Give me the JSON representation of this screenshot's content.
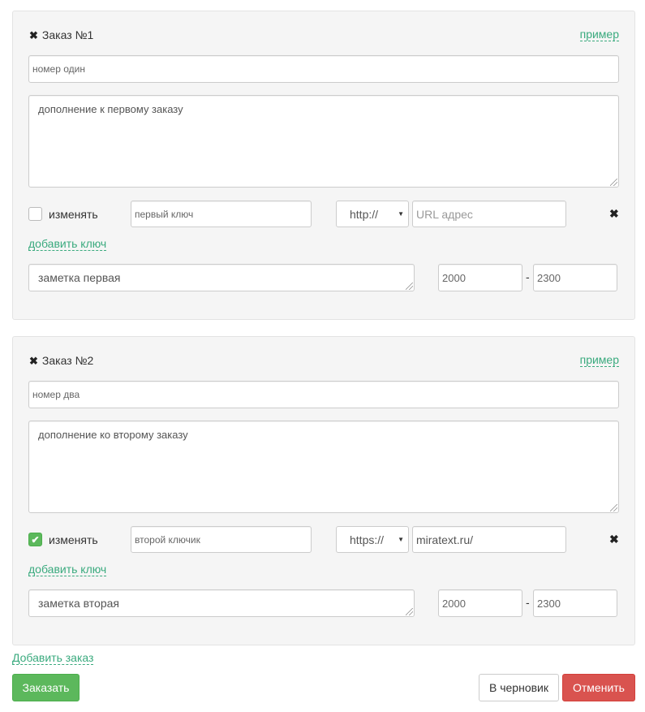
{
  "orders": [
    {
      "title": "Заказ №1",
      "example_link": "пример",
      "number_value": "номер один",
      "addition_value": "дополнение к первому заказу",
      "change_checked": false,
      "change_label": "изменять",
      "key_value": "первый ключ",
      "protocol": "http://",
      "url_placeholder": "URL адрес",
      "url_value": "",
      "add_key_link": "добавить ключ",
      "note_value": "заметка первая",
      "range_from": "2000",
      "range_to": "2300",
      "range_sep": "-"
    },
    {
      "title": "Заказ №2",
      "example_link": "пример",
      "number_value": "номер два",
      "addition_value": "дополнение ко второму заказу",
      "change_checked": true,
      "change_label": "изменять",
      "key_value": "второй ключик",
      "protocol": "https://",
      "url_placeholder": "URL адрес",
      "url_value": "miratext.ru/",
      "add_key_link": "добавить ключ",
      "note_value": "заметка вторая",
      "range_from": "2000",
      "range_to": "2300",
      "range_sep": "-"
    }
  ],
  "add_order_link": "Добавить заказ",
  "buttons": {
    "order": "Заказать",
    "draft": "В черновик",
    "cancel": "Отменить"
  },
  "colors": {
    "accent_link": "#3aaa7e",
    "success": "#5cb85c",
    "danger": "#d9534f"
  },
  "icons": {
    "remove": "times-icon",
    "checkbox": "checkbox-icon",
    "select_caret": "caret-down-icon"
  }
}
